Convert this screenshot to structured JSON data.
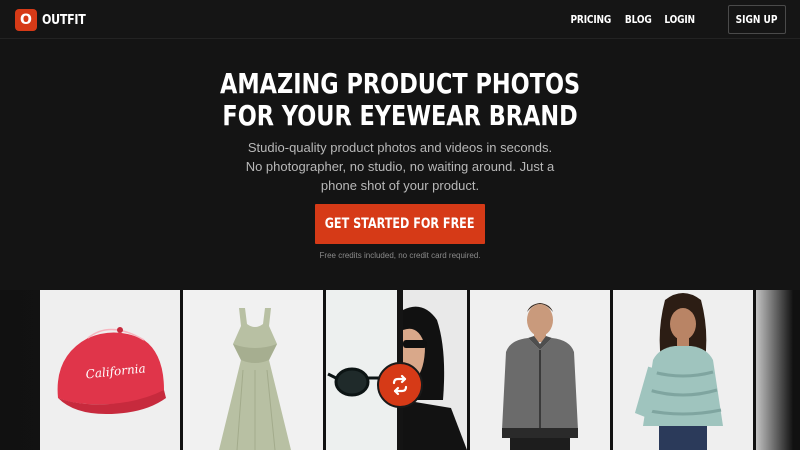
{
  "brand": {
    "logo_letter": "O",
    "name": "OUTFIT",
    "accent": "#d63a17"
  },
  "nav": {
    "links": [
      "PRICING",
      "BLOG",
      "LOGIN"
    ],
    "signup_label": "SIGN UP"
  },
  "hero": {
    "headline_line1": "AMAZING PRODUCT PHOTOS",
    "headline_line2": "FOR YOUR EYEWEAR BRAND",
    "subtitle": "Studio-quality product photos and videos in seconds. No photographer, no studio, no waiting around. Just a phone shot of your product.",
    "cta_label": "GET STARTED FOR FREE",
    "fine_print": "Free credits included, no credit card required."
  },
  "gallery": {
    "items": [
      {
        "icon": "cap-photo",
        "text": "California"
      },
      {
        "icon": "dress-photo"
      },
      {
        "icon": "sunglasses-photo"
      },
      {
        "icon": "model-sunglasses-photo"
      },
      {
        "icon": "man-jacket-photo"
      },
      {
        "icon": "woman-sweater-photo"
      }
    ],
    "swap_icon": "swap-arrows-icon"
  }
}
